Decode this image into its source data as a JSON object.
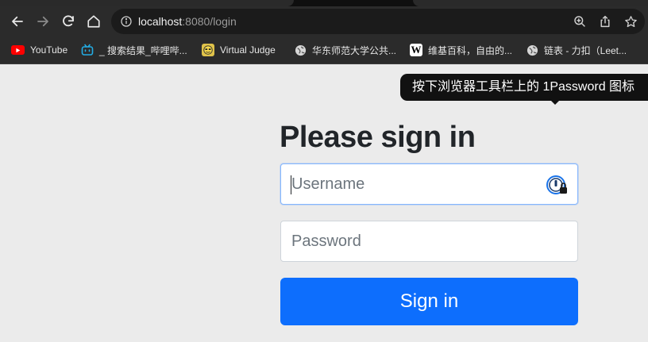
{
  "browser": {
    "url_host": "localhost",
    "url_rest": ":8080/login",
    "icons": {
      "back": "back-arrow-icon",
      "forward": "forward-arrow-icon",
      "reload": "reload-icon",
      "home": "home-icon",
      "site_info": "info-icon",
      "zoom": "zoom-icon",
      "share": "share-icon",
      "bookmark_star": "star-icon"
    }
  },
  "bookmarks": [
    {
      "label": "YouTube",
      "icon": "youtube-icon"
    },
    {
      "label": "_ 搜索结果_哔哩哔...",
      "icon": "bilibili-icon"
    },
    {
      "label": "Virtual Judge",
      "icon": "virtual-judge-icon"
    },
    {
      "label": "华东师范大学公共...",
      "icon": "globe-icon"
    },
    {
      "label": "维基百科，自由的...",
      "icon": "wikipedia-icon"
    },
    {
      "label": "链表 - 力扣（Leet...",
      "icon": "globe-icon"
    }
  ],
  "page": {
    "title": "Please sign in",
    "username_placeholder": "Username",
    "password_placeholder": "Password",
    "signin_label": "Sign in",
    "tooltip": "按下浏览器工具栏上的 1Password 图标"
  },
  "colors": {
    "primary": "#0d6efd",
    "focus_border": "#86b7fe",
    "page_bg": "#ebebeb"
  }
}
